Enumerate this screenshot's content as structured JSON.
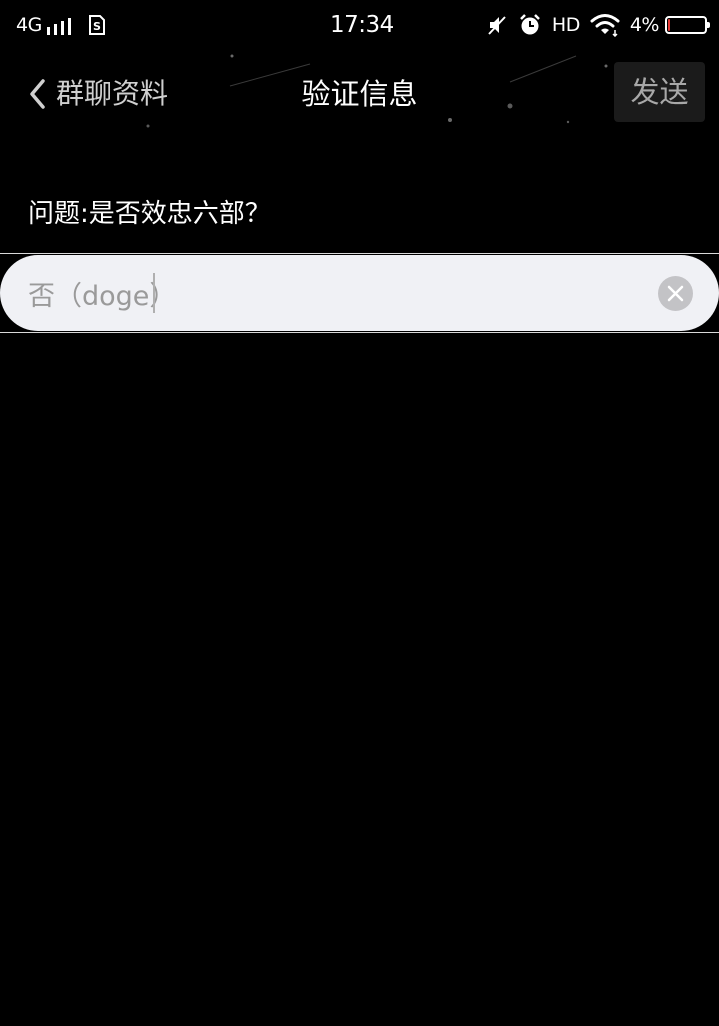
{
  "status_bar": {
    "network": "4G",
    "time": "17:34",
    "hd": "HD",
    "battery_percent": "4%",
    "battery_level": 0.04,
    "icons": [
      "signal-icon",
      "sim-icon",
      "mute-icon",
      "alarm-icon",
      "wifi-icon",
      "battery-icon"
    ]
  },
  "nav": {
    "back_label": "群聊资料",
    "title": "验证信息",
    "send_label": "发送"
  },
  "question": {
    "text": "问题:是否效忠六部？"
  },
  "answer_input": {
    "value": "否（doge）"
  },
  "colors": {
    "background": "#000000",
    "input_background": "#f0f1f5",
    "battery_low": "#e53935"
  }
}
